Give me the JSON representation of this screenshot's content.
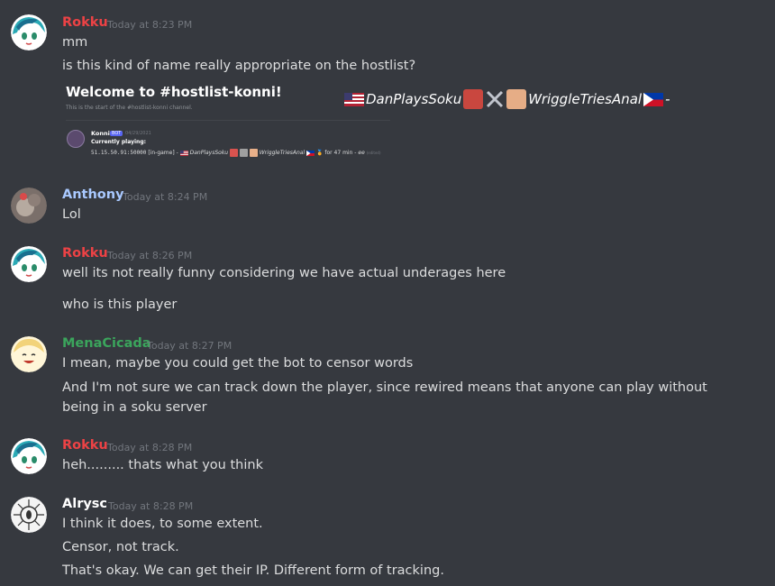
{
  "colors": {
    "background": "#36393f",
    "rokku": "#ed4245",
    "anthony": "#a9c9ff",
    "menacicada": "#3ba55c",
    "alrysc": "#ffffff",
    "timestamp": "#72767d",
    "text": "#dcddde"
  },
  "messages": [
    {
      "author": "Rokku",
      "timestamp": "Today at 8:23 PM",
      "avatar": "rokku-avatar",
      "lines": [
        "mm",
        "is this kind of name really appropriate on the hostlist?"
      ],
      "embed": {
        "title": "Welcome to #hostlist-konni!",
        "subtitle": "This is the start of the #hostlist-konni channel.",
        "bot_name": "Konni",
        "bot_badge": "BOT",
        "bot_date": "04/29/2021",
        "playing_label": "Currently playing:",
        "address": "51.15.50.91:50000",
        "status": "[in-game] -",
        "player1": "DanPlaysSoku",
        "player2": "WriggleTriesAnal",
        "duration": "for 47 min -",
        "note": "ee",
        "edited": "(edited)"
      },
      "players_overlay": {
        "player1": "DanPlaysSoku",
        "player2": "WriggleTriesAnal",
        "suffix": "-"
      }
    },
    {
      "author": "Anthony",
      "timestamp": "Today at 8:24 PM",
      "avatar": "anthony-avatar",
      "lines": [
        "Lol"
      ]
    },
    {
      "author": "Rokku",
      "timestamp": "Today at 8:26 PM",
      "avatar": "rokku-avatar",
      "lines": [
        "well its not really funny considering we have actual underages here",
        "who is this player"
      ]
    },
    {
      "author": "MenaCicada",
      "timestamp": "Today at 8:27 PM",
      "avatar": "menacicada-avatar",
      "lines": [
        "I mean, maybe you could get the bot to censor words",
        "And I'm not sure we can track down the player, since rewired means that anyone can play without being in a soku server"
      ]
    },
    {
      "author": "Rokku",
      "timestamp": "Today at 8:28 PM",
      "avatar": "rokku-avatar",
      "lines": [
        "heh......... thats what you think"
      ]
    },
    {
      "author": "Alrysc",
      "timestamp": "Today at 8:28 PM",
      "avatar": "alrysc-avatar",
      "lines": [
        "I think it does, to some extent.",
        "Censor, not track.",
        "That's okay. We can get their IP. Different form of tracking."
      ]
    }
  ]
}
